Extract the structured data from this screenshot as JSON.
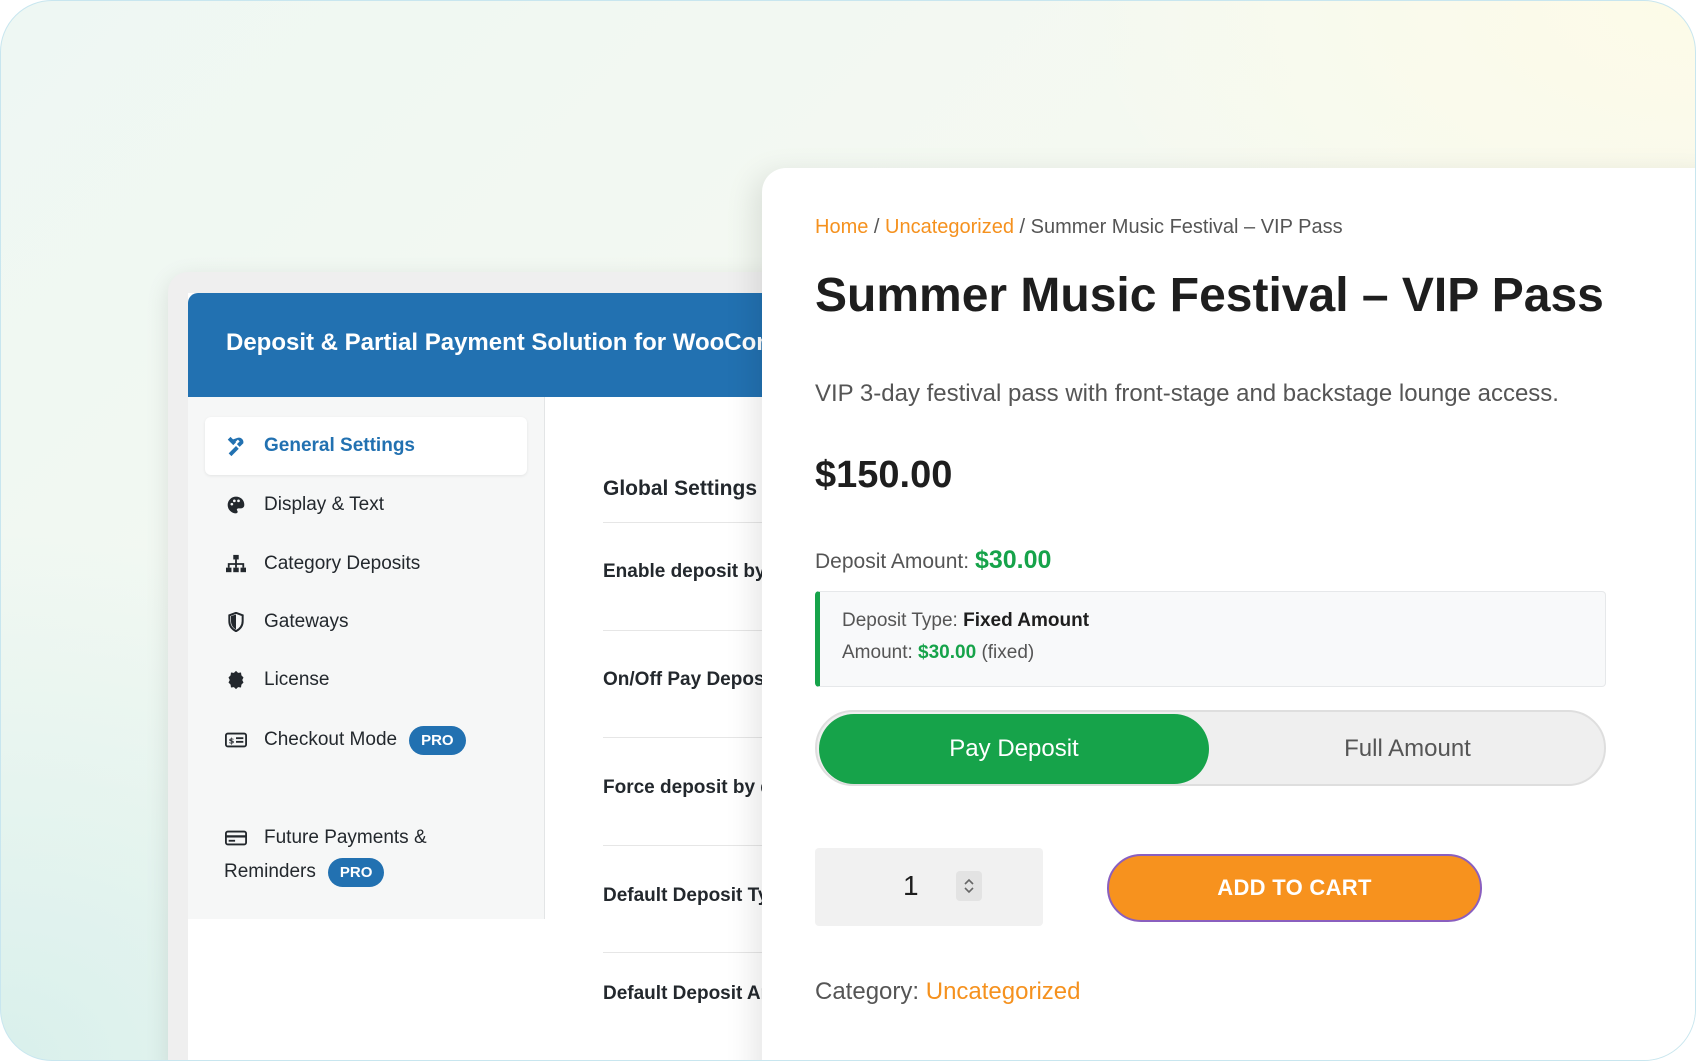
{
  "admin": {
    "header_title": "Deposit & Partial Payment Solution for WooCommerce",
    "sidebar": {
      "items": [
        {
          "label": "General Settings",
          "icon": "tools-icon",
          "active": true
        },
        {
          "label": "Display & Text",
          "icon": "palette-icon"
        },
        {
          "label": "Category Deposits",
          "icon": "sitemap-icon"
        },
        {
          "label": "Gateways",
          "icon": "shield-icon"
        },
        {
          "label": "License",
          "icon": "badge-icon"
        },
        {
          "label": "Checkout Mode",
          "icon": "money-icon",
          "badge": "PRO"
        },
        {
          "label_line1": "Future Payments &",
          "label_line2": "Reminders",
          "icon": "card-icon",
          "badge": "PRO"
        }
      ]
    },
    "content": {
      "section_title": "Global Settings",
      "fields": [
        "Enable deposit by default",
        "On/Off Pay Deposit",
        "Force deposit by default",
        "Default Deposit Type",
        "Default Deposit Amount"
      ]
    }
  },
  "product": {
    "breadcrumb": {
      "home": "Home",
      "sep": " / ",
      "category": "Uncategorized",
      "current": "Summer Music Festival – VIP Pass"
    },
    "title": "Summer Music Festival – VIP Pass",
    "description": "VIP 3-day festival pass with front-stage and backstage lounge access.",
    "price": "$150.00",
    "deposit_amount_label": "Deposit Amount:",
    "deposit_amount_value": "$30.00",
    "deposit_type_label": "Deposit Type:",
    "deposit_type_value": "Fixed Amount",
    "amount_label": "Amount:",
    "amount_value": "$30.00",
    "amount_suffix": "(fixed)",
    "toggle": {
      "pay_deposit": "Pay Deposit",
      "full_amount": "Full Amount",
      "selected": "pay_deposit"
    },
    "quantity": "1",
    "add_to_cart": "ADD TO CART",
    "category_label": "Category:",
    "category_value": "Uncategorized"
  },
  "colors": {
    "admin_blue": "#2271b1",
    "accent_orange": "#f5911e",
    "deposit_green": "#16a34a",
    "cart_button": "#f7921e"
  }
}
